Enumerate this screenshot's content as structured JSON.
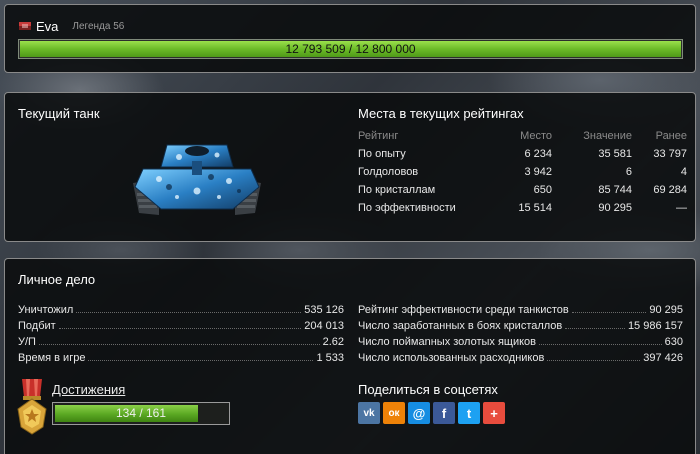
{
  "user": {
    "name": "Eva",
    "rank": "Легенда 56",
    "xp_text": "12 793 509 / 12 800 000",
    "xp_progress": 0.9995
  },
  "current_tank": {
    "title": "Текущий танк"
  },
  "ratings": {
    "title": "Места в текущих рейтингах",
    "headers": [
      "Рейтинг",
      "Место",
      "Значение",
      "Ранее"
    ],
    "rows": [
      [
        "По опыту",
        "6 234",
        "35 581",
        "33 797"
      ],
      [
        "Голдоловов",
        "3 942",
        "6",
        "4"
      ],
      [
        "По кристаллам",
        "650",
        "85 744",
        "69 284"
      ],
      [
        "По эффективности",
        "15 514",
        "90 295",
        "—"
      ]
    ]
  },
  "personal": {
    "title": "Личное дело",
    "left_stats": [
      {
        "label": "Уничтожил",
        "value": "535 126"
      },
      {
        "label": "Подбит",
        "value": "204 013"
      },
      {
        "label": "У/П",
        "value": "2.62"
      },
      {
        "label": "Время в игре",
        "value": "1 533"
      }
    ],
    "right_stats": [
      {
        "label": "Рейтинг эффективности среди танкистов",
        "value": "90 295"
      },
      {
        "label": "Число заработанных в боях кристаллов",
        "value": "15 986 157"
      },
      {
        "label": "Число поймanных золотых ящиков",
        "value": "630"
      },
      {
        "label": "Число использованных расходников",
        "value": "397 426"
      }
    ]
  },
  "achievements": {
    "label": "Достижения",
    "text": "134 / 161",
    "progress": 0.832
  },
  "share": {
    "title": "Поделиться в соцсетях",
    "buttons": [
      {
        "icon": "vk-icon",
        "glyph": "vk",
        "color": "#4c75a3"
      },
      {
        "icon": "odnoklassniki-icon",
        "glyph": "ок",
        "color": "#ee8208"
      },
      {
        "icon": "mail-icon",
        "glyph": "@",
        "color": "#168de2"
      },
      {
        "icon": "facebook-icon",
        "glyph": "f",
        "color": "#3b5998"
      },
      {
        "icon": "twitter-icon",
        "glyph": "t",
        "color": "#1da1f2"
      },
      {
        "icon": "plus-icon",
        "glyph": "+",
        "color": "#e84c3d"
      }
    ]
  }
}
